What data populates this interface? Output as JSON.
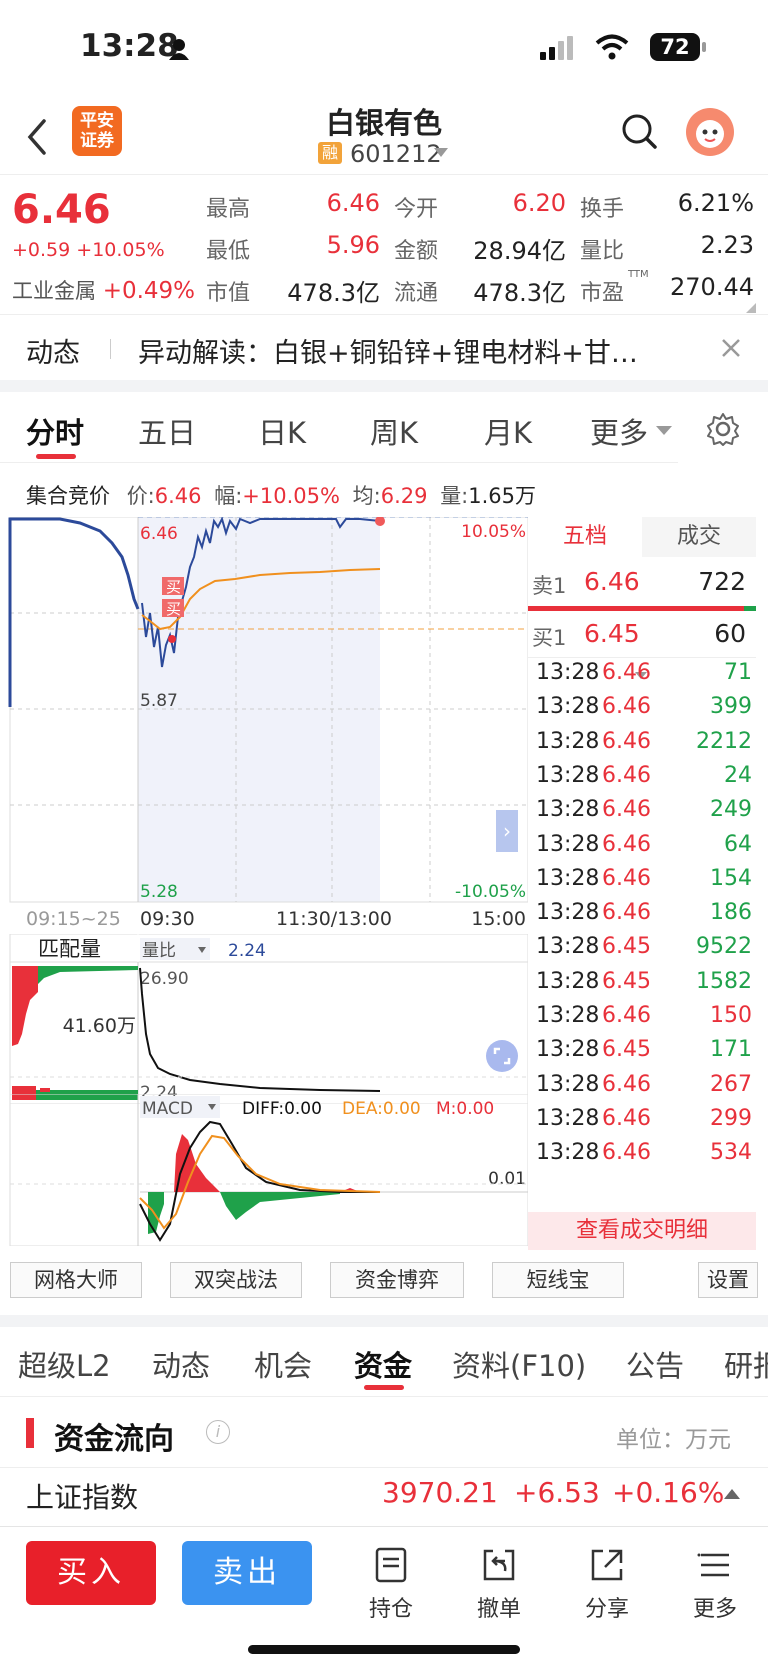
{
  "status": {
    "time": "13:28",
    "battery": "72"
  },
  "header": {
    "title": "白银有色",
    "broker_logo": "平安证券",
    "margin_badge": "融",
    "code": "601212"
  },
  "quote": {
    "price": "6.46",
    "change": "+0.59",
    "change_pct": "+10.05%",
    "sector_label": "工业金属",
    "sector_pct": "+0.49%",
    "high_label": "最高",
    "high": "6.46",
    "open_label": "今开",
    "open": "6.20",
    "turnover_label": "换手",
    "turnover": "6.21%",
    "low_label": "最低",
    "low": "5.96",
    "amount_label": "金额",
    "amount": "28.94亿",
    "ratio_label": "量比",
    "ratio": "2.23",
    "mcap_label": "市值",
    "mcap": "478.3亿",
    "float_label": "流通",
    "float": "478.3亿",
    "pe_label": "市盈",
    "pe_sup": "TTM",
    "pe": "270.44"
  },
  "news": {
    "tag": "动态",
    "text": "异动解读：白银+铜铅锌+锂电材料+甘…"
  },
  "chart_tabs": [
    "分时",
    "五日",
    "日K",
    "周K",
    "月K",
    "更多"
  ],
  "auction": {
    "label": "集合竞价",
    "price_label": "价:",
    "price": "6.46",
    "amp_label": "幅:",
    "amp": "+10.05%",
    "avg_label": "均:",
    "avg": "6.29",
    "vol_label": "量:",
    "vol": "1.65万"
  },
  "intraday": {
    "top": "6.46",
    "mid": "5.87",
    "bottom": "5.28",
    "top_pct": "10.05%",
    "bottom_pct": "-10.05%",
    "t_auction": "09:15~25",
    "t_open": "09:30",
    "t_mid": "11:30/13:00",
    "t_close": "15:00",
    "buy_marker": "买"
  },
  "match": {
    "label": "匹配量",
    "value": "41.60万",
    "ratio_label": "量比",
    "ratio_value": "2.24",
    "top": "26.90",
    "bottom": "2.24"
  },
  "macd": {
    "label": "MACD",
    "diff": "DIFF:0.00",
    "dea": "DEA:0.00",
    "m": "M:0.00",
    "axis": "0.01"
  },
  "book": {
    "tab_five": "五档",
    "tab_deal": "成交",
    "sell1_label": "卖1",
    "sell1_price": "6.46",
    "sell1_vol": "722",
    "buy1_label": "买1",
    "buy1_price": "6.45",
    "buy1_vol": "60"
  },
  "trades": [
    {
      "t": "13:28",
      "p": "6.46",
      "v": "71",
      "c": "#1fa14a"
    },
    {
      "t": "13:28",
      "p": "6.46",
      "v": "399",
      "c": "#1fa14a"
    },
    {
      "t": "13:28",
      "p": "6.46",
      "v": "2212",
      "c": "#1fa14a"
    },
    {
      "t": "13:28",
      "p": "6.46",
      "v": "24",
      "c": "#1fa14a"
    },
    {
      "t": "13:28",
      "p": "6.46",
      "v": "249",
      "c": "#1fa14a"
    },
    {
      "t": "13:28",
      "p": "6.46",
      "v": "64",
      "c": "#1fa14a"
    },
    {
      "t": "13:28",
      "p": "6.46",
      "v": "154",
      "c": "#1fa14a"
    },
    {
      "t": "13:28",
      "p": "6.46",
      "v": "186",
      "c": "#1fa14a"
    },
    {
      "t": "13:28",
      "p": "6.45",
      "v": "9522",
      "c": "#1fa14a"
    },
    {
      "t": "13:28",
      "p": "6.45",
      "v": "1582",
      "c": "#1fa14a"
    },
    {
      "t": "13:28",
      "p": "6.46",
      "v": "150",
      "c": "#e8303a"
    },
    {
      "t": "13:28",
      "p": "6.45",
      "v": "171",
      "c": "#1fa14a"
    },
    {
      "t": "13:28",
      "p": "6.46",
      "v": "267",
      "c": "#e8303a"
    },
    {
      "t": "13:28",
      "p": "6.46",
      "v": "299",
      "c": "#e8303a"
    },
    {
      "t": "13:28",
      "p": "6.46",
      "v": "534",
      "c": "#e8303a"
    }
  ],
  "trades_link": "查看成交明细",
  "tools": [
    "网格大师",
    "双突战法",
    "资金博弈",
    "短线宝",
    "设置"
  ],
  "lower_tabs": [
    "超级L2",
    "动态",
    "机会",
    "资金",
    "资料(F10)",
    "公告",
    "研报"
  ],
  "flow": {
    "title": "资金流向",
    "unit": "单位：万元"
  },
  "index": {
    "name": "上证指数",
    "value": "3970.21",
    "change": "+6.53",
    "pct": "+0.16%"
  },
  "bottom": {
    "buy": "买入",
    "sell": "卖出",
    "hold": "持仓",
    "cancel": "撤单",
    "share": "分享",
    "more": "更多"
  },
  "colors": {
    "up": "#e8303a",
    "down": "#1fa14a",
    "price_line": "#2c4a9a",
    "avg_line": "#f0901e",
    "buy_button": "#e8202a",
    "sell_button": "#3b93f0"
  }
}
